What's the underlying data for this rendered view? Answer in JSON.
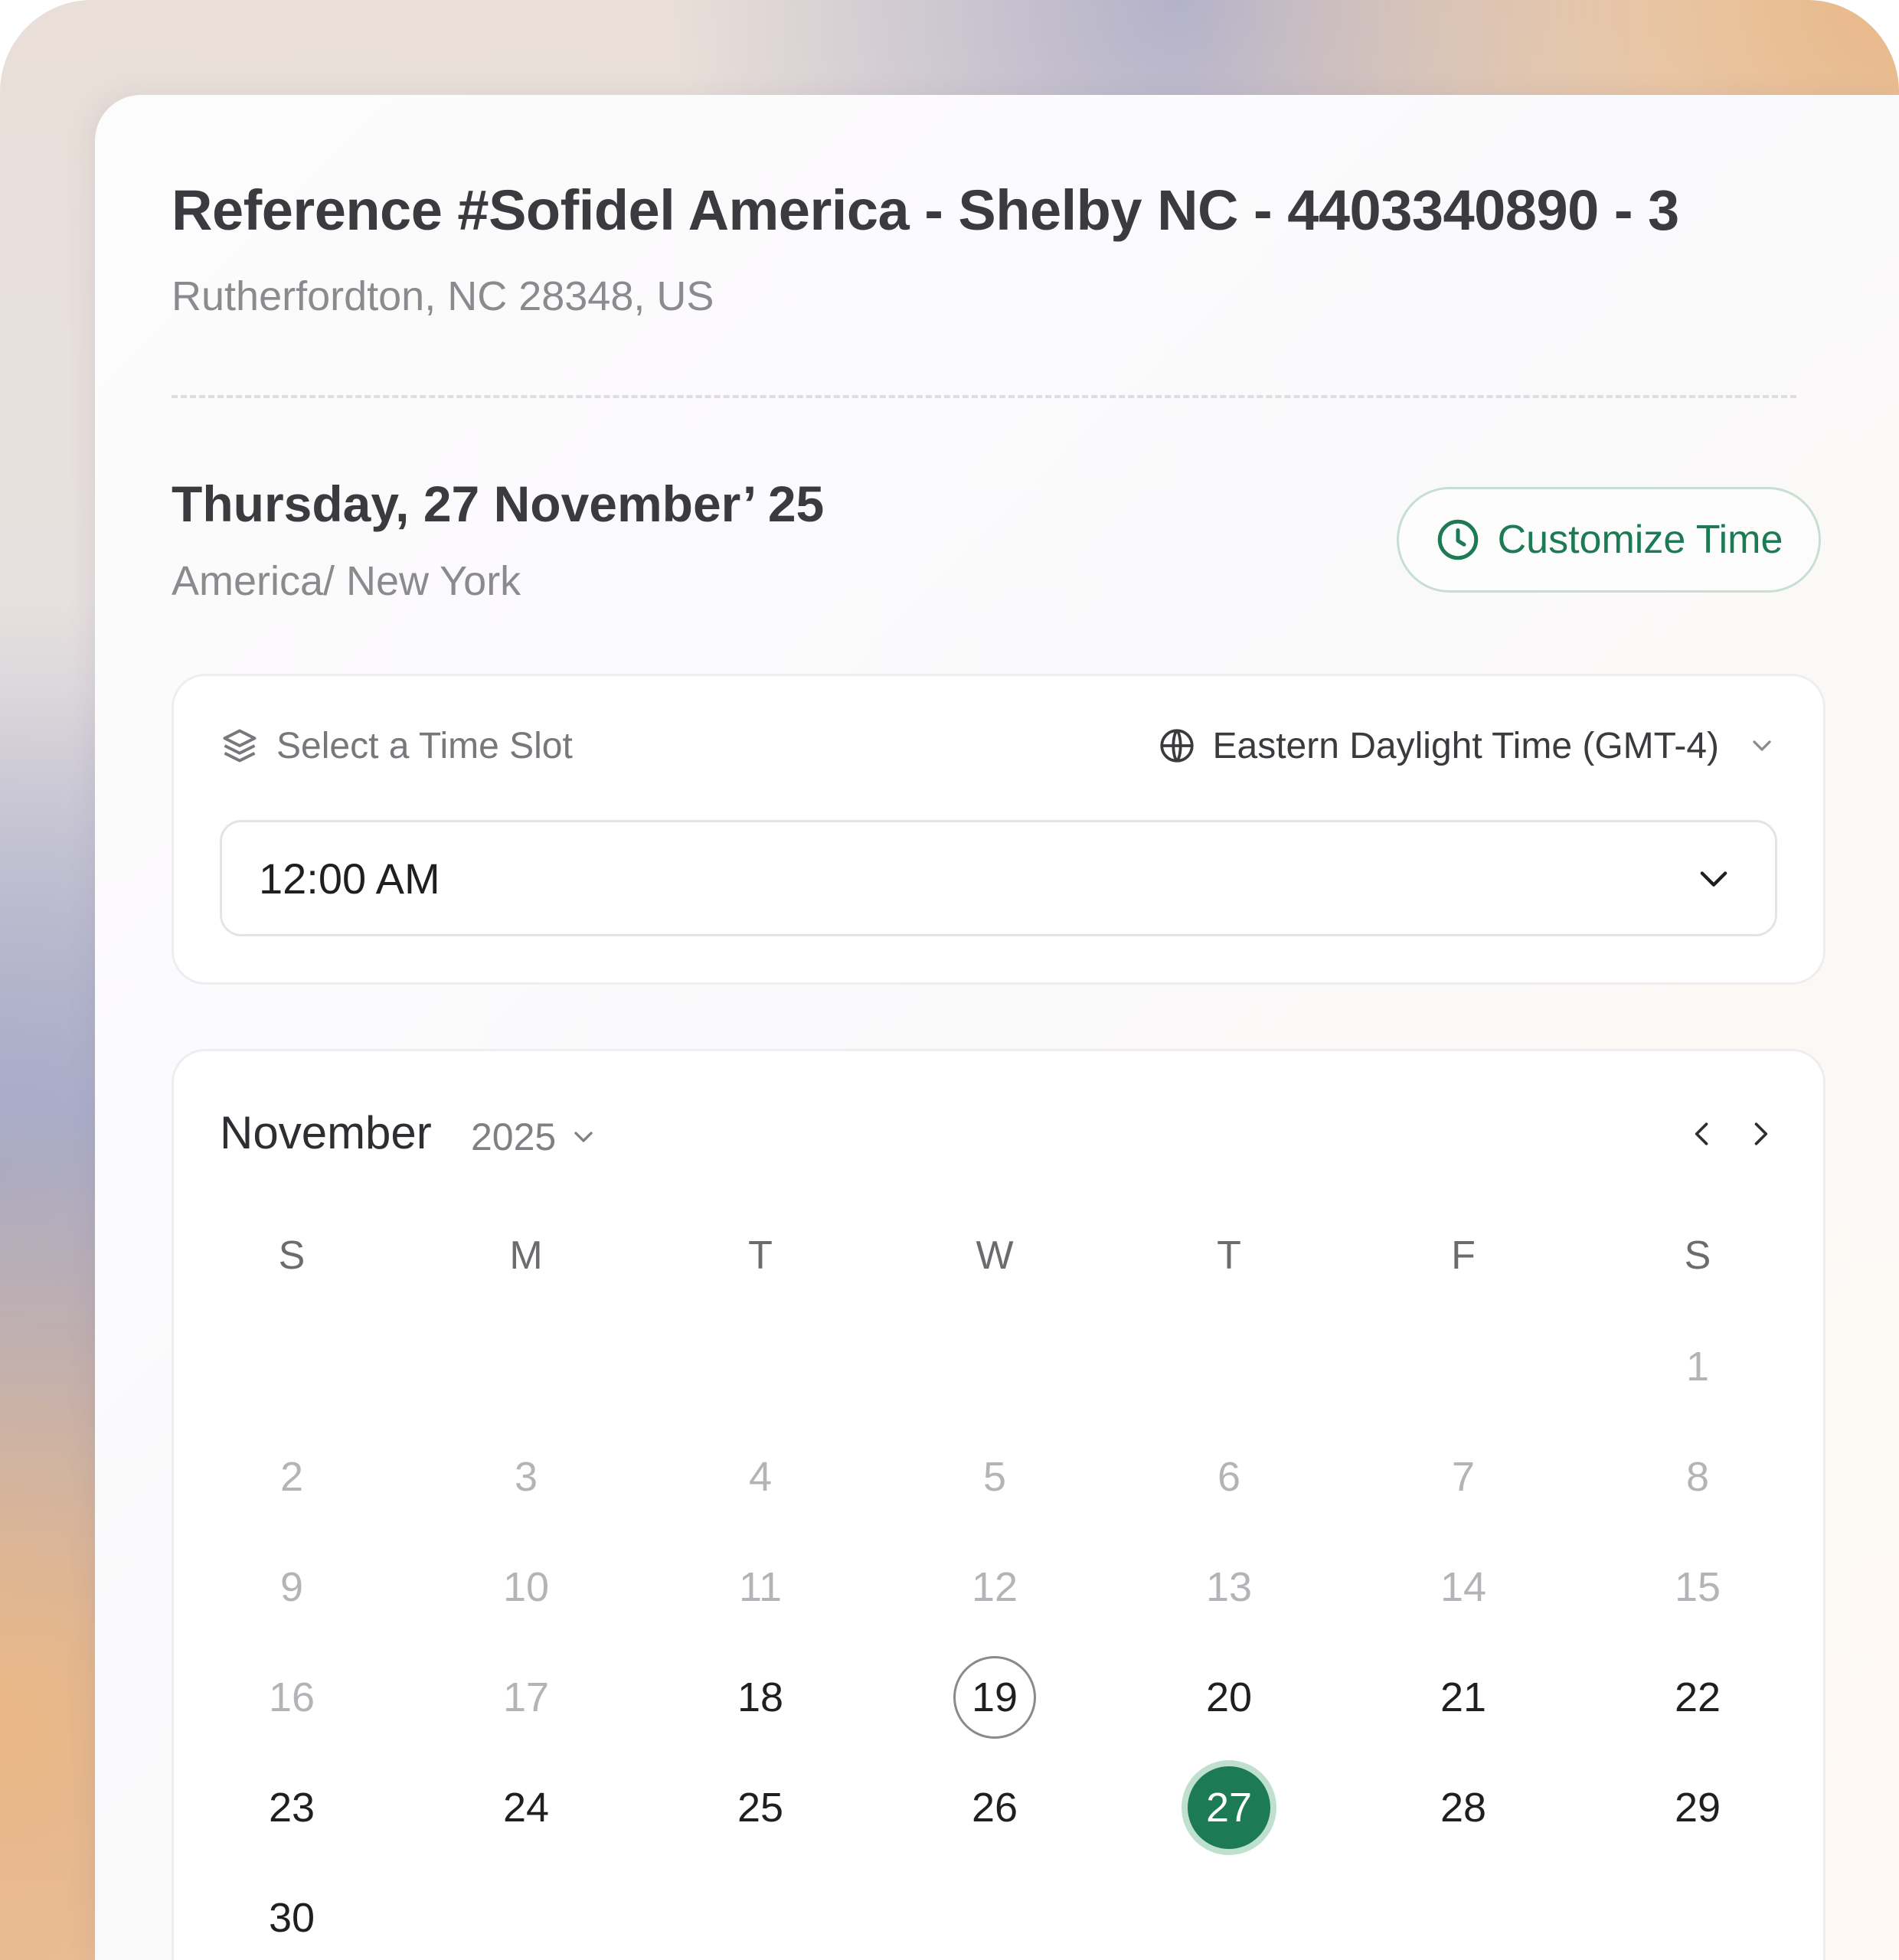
{
  "header": {
    "title": "Reference #Sofidel America - Shelby NC - 4403340890 - 3",
    "address": "Rutherfordton, NC 28348, US"
  },
  "schedule": {
    "date": "Thursday, 27 November’ 25",
    "timezone_name": "America/ New York",
    "customize_label": "Customize Time"
  },
  "time_slot": {
    "label": "Select a Time Slot",
    "timezone_option": "Eastern Daylight Time (GMT-4)",
    "selected_time": "12:00 AM"
  },
  "calendar": {
    "month": "November",
    "year": "2025",
    "weekdays": [
      "S",
      "M",
      "T",
      "W",
      "T",
      "F",
      "S"
    ],
    "today": 19,
    "selected": 27,
    "first_available": 18,
    "days": [
      "1",
      "2",
      "3",
      "4",
      "5",
      "6",
      "7",
      "8",
      "9",
      "10",
      "11",
      "12",
      "13",
      "14",
      "15",
      "16",
      "17",
      "18",
      "19",
      "20",
      "21",
      "22",
      "23",
      "24",
      "25",
      "26",
      "27",
      "28",
      "29",
      "30"
    ]
  },
  "colors": {
    "accent": "#1c7a55",
    "accent_ring": "#bfe0cf",
    "past_day": "#b4b4b8"
  },
  "icons": {
    "customize": "clock-icon",
    "slot": "layers-icon",
    "timezone": "globe-icon",
    "dropdown": "chevron-down-icon",
    "prev": "chevron-left-icon",
    "next": "chevron-right-icon"
  }
}
